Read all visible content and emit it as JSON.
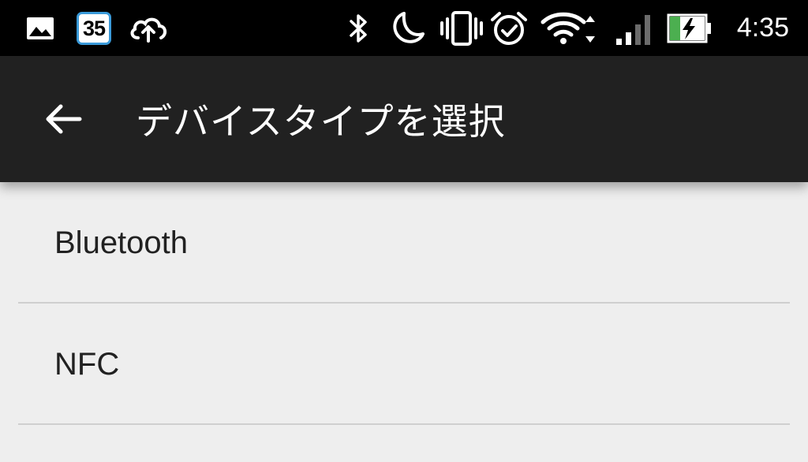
{
  "status_bar": {
    "notification_count": "35",
    "time": "4:35",
    "icons": [
      "image-icon",
      "calendar-badge-icon",
      "cloud-upload-icon",
      "bluetooth-icon",
      "do-not-disturb-moon-icon",
      "vibrate-icon",
      "alarm-icon",
      "wifi-icon",
      "cellular-signal-icon",
      "battery-charging-icon"
    ]
  },
  "app_bar": {
    "title": "デバイスタイプを選択",
    "back_icon": "arrow-back-icon"
  },
  "device_types": [
    {
      "label": "Bluetooth"
    },
    {
      "label": "NFC"
    }
  ],
  "colors": {
    "status_bar": "#000000",
    "app_bar": "#212121",
    "background": "#eeeeee",
    "divider": "#cfcfcf",
    "text": "#212121",
    "battery_fill": "#4caf50"
  }
}
